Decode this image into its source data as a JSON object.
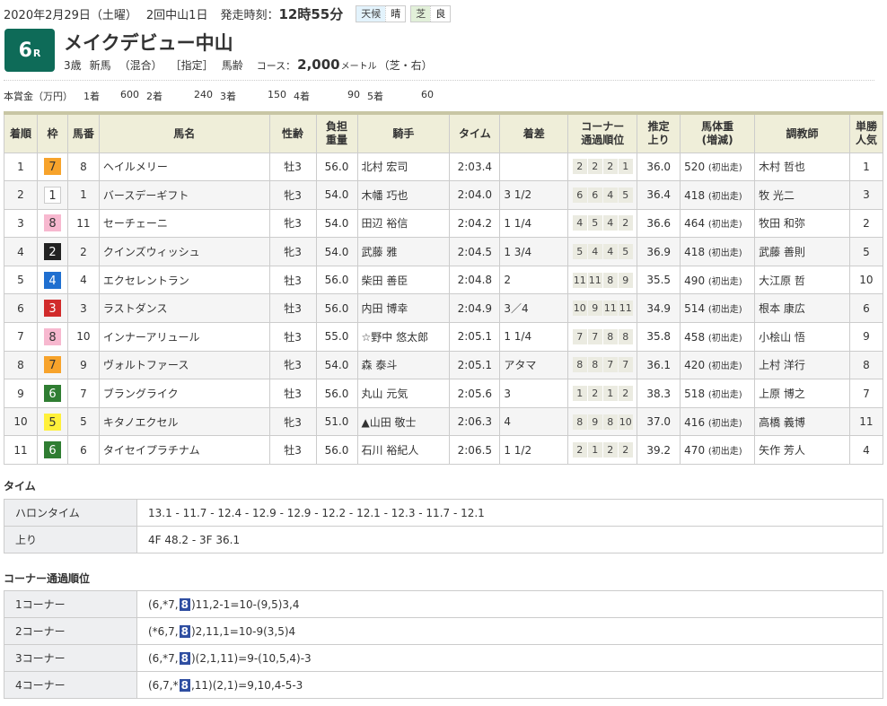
{
  "header": {
    "date": "2020年2月29日（土曜）",
    "meeting": "2回中山1日",
    "start_label": "発走時刻：",
    "start_time": "12時55分",
    "weather_label": "天候",
    "weather_value": "晴",
    "surface_label": "芝",
    "surface_value": "良"
  },
  "race": {
    "number": "6",
    "number_suffix": "R",
    "title": "メイクデビュー中山",
    "conditions": [
      "3歳",
      "新馬",
      "（混合）",
      "［指定］",
      "馬齢"
    ],
    "course_label": "コース：",
    "distance": "2,000",
    "distance_unit": "メートル",
    "course_detail": "（芝・右）"
  },
  "prize": {
    "label": "本賞金（万円）",
    "items": [
      {
        "place": "1着",
        "amount": "600"
      },
      {
        "place": "2着",
        "amount": "240"
      },
      {
        "place": "3着",
        "amount": "150"
      },
      {
        "place": "4着",
        "amount": "90"
      },
      {
        "place": "5着",
        "amount": "60"
      }
    ]
  },
  "table": {
    "headers": {
      "rank": "着順",
      "waku": "枠",
      "num": "馬番",
      "name": "馬名",
      "sexage": "性齢",
      "weight1": "負担",
      "weight2": "重量",
      "jockey": "騎手",
      "time": "タイム",
      "margin": "着差",
      "corner1": "コーナー",
      "corner2": "通過順位",
      "last1": "推定",
      "last2": "上り",
      "body1": "馬体重",
      "body2": "(増減)",
      "trainer": "調教師",
      "pop1": "単勝",
      "pop2": "人気"
    },
    "waku_colors": {
      "1": {
        "bg": "#ffffff",
        "fg": "#333333",
        "border": "#cccccc"
      },
      "2": {
        "bg": "#222222",
        "fg": "#ffffff",
        "border": "#222222"
      },
      "3": {
        "bg": "#d12b2b",
        "fg": "#ffffff",
        "border": "#d12b2b"
      },
      "4": {
        "bg": "#1f6fd0",
        "fg": "#ffffff",
        "border": "#1f6fd0"
      },
      "5": {
        "bg": "#fff03a",
        "fg": "#333333",
        "border": "#fff03a"
      },
      "6": {
        "bg": "#2f7d32",
        "fg": "#ffffff",
        "border": "#2f7d32"
      },
      "7": {
        "bg": "#f7a32b",
        "fg": "#333333",
        "border": "#f7a32b"
      },
      "8": {
        "bg": "#f7b8cf",
        "fg": "#333333",
        "border": "#f7b8cf"
      }
    },
    "rows": [
      {
        "rank": "1",
        "waku": "7",
        "num": "8",
        "name": "ヘイルメリー",
        "sexage": "牡3",
        "weight": "56.0",
        "jockey": "北村 宏司",
        "time": "2:03.4",
        "margin": "",
        "corners": [
          "2",
          "2",
          "2",
          "1"
        ],
        "last3f": "36.0",
        "body": "520",
        "body_note": "(初出走)",
        "trainer": "木村 哲也",
        "pop": "1"
      },
      {
        "rank": "2",
        "waku": "1",
        "num": "1",
        "name": "バースデーギフト",
        "sexage": "牝3",
        "weight": "54.0",
        "jockey": "木幡 巧也",
        "time": "2:04.0",
        "margin": "3 1/2",
        "corners": [
          "6",
          "6",
          "4",
          "5"
        ],
        "last3f": "36.4",
        "body": "418",
        "body_note": "(初出走)",
        "trainer": "牧 光二",
        "pop": "3"
      },
      {
        "rank": "3",
        "waku": "8",
        "num": "11",
        "name": "セーチェーニ",
        "sexage": "牝3",
        "weight": "54.0",
        "jockey": "田辺 裕信",
        "time": "2:04.2",
        "margin": "1 1/4",
        "corners": [
          "4",
          "5",
          "4",
          "2"
        ],
        "last3f": "36.6",
        "body": "464",
        "body_note": "(初出走)",
        "trainer": "牧田 和弥",
        "pop": "2"
      },
      {
        "rank": "4",
        "waku": "2",
        "num": "2",
        "name": "クインズウィッシュ",
        "sexage": "牝3",
        "weight": "54.0",
        "jockey": "武藤 雅",
        "time": "2:04.5",
        "margin": "1 3/4",
        "corners": [
          "5",
          "4",
          "4",
          "5"
        ],
        "last3f": "36.9",
        "body": "418",
        "body_note": "(初出走)",
        "trainer": "武藤 善則",
        "pop": "5"
      },
      {
        "rank": "5",
        "waku": "4",
        "num": "4",
        "name": "エクセレントラン",
        "sexage": "牡3",
        "weight": "56.0",
        "jockey": "柴田 善臣",
        "time": "2:04.8",
        "margin": "2",
        "corners": [
          "11",
          "11",
          "8",
          "9"
        ],
        "last3f": "35.5",
        "body": "490",
        "body_note": "(初出走)",
        "trainer": "大江原 哲",
        "pop": "10"
      },
      {
        "rank": "6",
        "waku": "3",
        "num": "3",
        "name": "ラストダンス",
        "sexage": "牡3",
        "weight": "56.0",
        "jockey": "内田 博幸",
        "time": "2:04.9",
        "margin": "3／4",
        "corners": [
          "10",
          "9",
          "11",
          "11"
        ],
        "last3f": "34.9",
        "body": "514",
        "body_note": "(初出走)",
        "trainer": "根本 康広",
        "pop": "6"
      },
      {
        "rank": "7",
        "waku": "8",
        "num": "10",
        "name": "インナーアリュール",
        "sexage": "牡3",
        "weight": "55.0",
        "jockey": "☆野中 悠太郎",
        "time": "2:05.1",
        "margin": "1 1/4",
        "corners": [
          "7",
          "7",
          "8",
          "8"
        ],
        "last3f": "35.8",
        "body": "458",
        "body_note": "(初出走)",
        "trainer": "小桧山 悟",
        "pop": "9"
      },
      {
        "rank": "8",
        "waku": "7",
        "num": "9",
        "name": "ヴォルトファース",
        "sexage": "牝3",
        "weight": "54.0",
        "jockey": "森 泰斗",
        "time": "2:05.1",
        "margin": "アタマ",
        "corners": [
          "8",
          "8",
          "7",
          "7"
        ],
        "last3f": "36.1",
        "body": "420",
        "body_note": "(初出走)",
        "trainer": "上村 洋行",
        "pop": "8"
      },
      {
        "rank": "9",
        "waku": "6",
        "num": "7",
        "name": "ブラングライク",
        "sexage": "牡3",
        "weight": "56.0",
        "jockey": "丸山 元気",
        "time": "2:05.6",
        "margin": "3",
        "corners": [
          "1",
          "2",
          "1",
          "2"
        ],
        "last3f": "38.3",
        "body": "518",
        "body_note": "(初出走)",
        "trainer": "上原 博之",
        "pop": "7"
      },
      {
        "rank": "10",
        "waku": "5",
        "num": "5",
        "name": "キタノエクセル",
        "sexage": "牝3",
        "weight": "51.0",
        "jockey": "▲山田 敬士",
        "time": "2:06.3",
        "margin": "4",
        "corners": [
          "8",
          "9",
          "8",
          "10"
        ],
        "last3f": "37.0",
        "body": "416",
        "body_note": "(初出走)",
        "trainer": "高橋 義博",
        "pop": "11"
      },
      {
        "rank": "11",
        "waku": "6",
        "num": "6",
        "name": "タイセイプラチナム",
        "sexage": "牡3",
        "weight": "56.0",
        "jockey": "石川 裕紀人",
        "time": "2:06.5",
        "margin": "1 1/2",
        "corners": [
          "2",
          "1",
          "2",
          "2"
        ],
        "last3f": "39.2",
        "body": "470",
        "body_note": "(初出走)",
        "trainer": "矢作 芳人",
        "pop": "4"
      }
    ]
  },
  "times": {
    "title": "タイム",
    "rows": [
      {
        "label": "ハロンタイム",
        "value": "13.1 - 11.7 - 12.4 - 12.9 - 12.9 - 12.2 - 12.1 - 12.3 - 11.7 - 12.1"
      },
      {
        "label": "上り",
        "value": "4F 48.2 - 3F 36.1"
      }
    ]
  },
  "corners": {
    "title": "コーナー通過順位",
    "highlight_color": "#2f4ea1",
    "rows": [
      {
        "label": "1コーナー",
        "before": "(6,*7,",
        "highlight": "8",
        "after": ")11,2-1=10-(9,5)3,4"
      },
      {
        "label": "2コーナー",
        "before": "(*6,7,",
        "highlight": "8",
        "after": ")2,11,1=10-9(3,5)4"
      },
      {
        "label": "3コーナー",
        "before": "(6,*7,",
        "highlight": "8",
        "after": ")(2,1,11)=9-(10,5,4)-3"
      },
      {
        "label": "4コーナー",
        "before": "(6,7,*",
        "highlight": "8",
        "after": ",11)(2,1)=9,10,4-5-3"
      }
    ]
  }
}
